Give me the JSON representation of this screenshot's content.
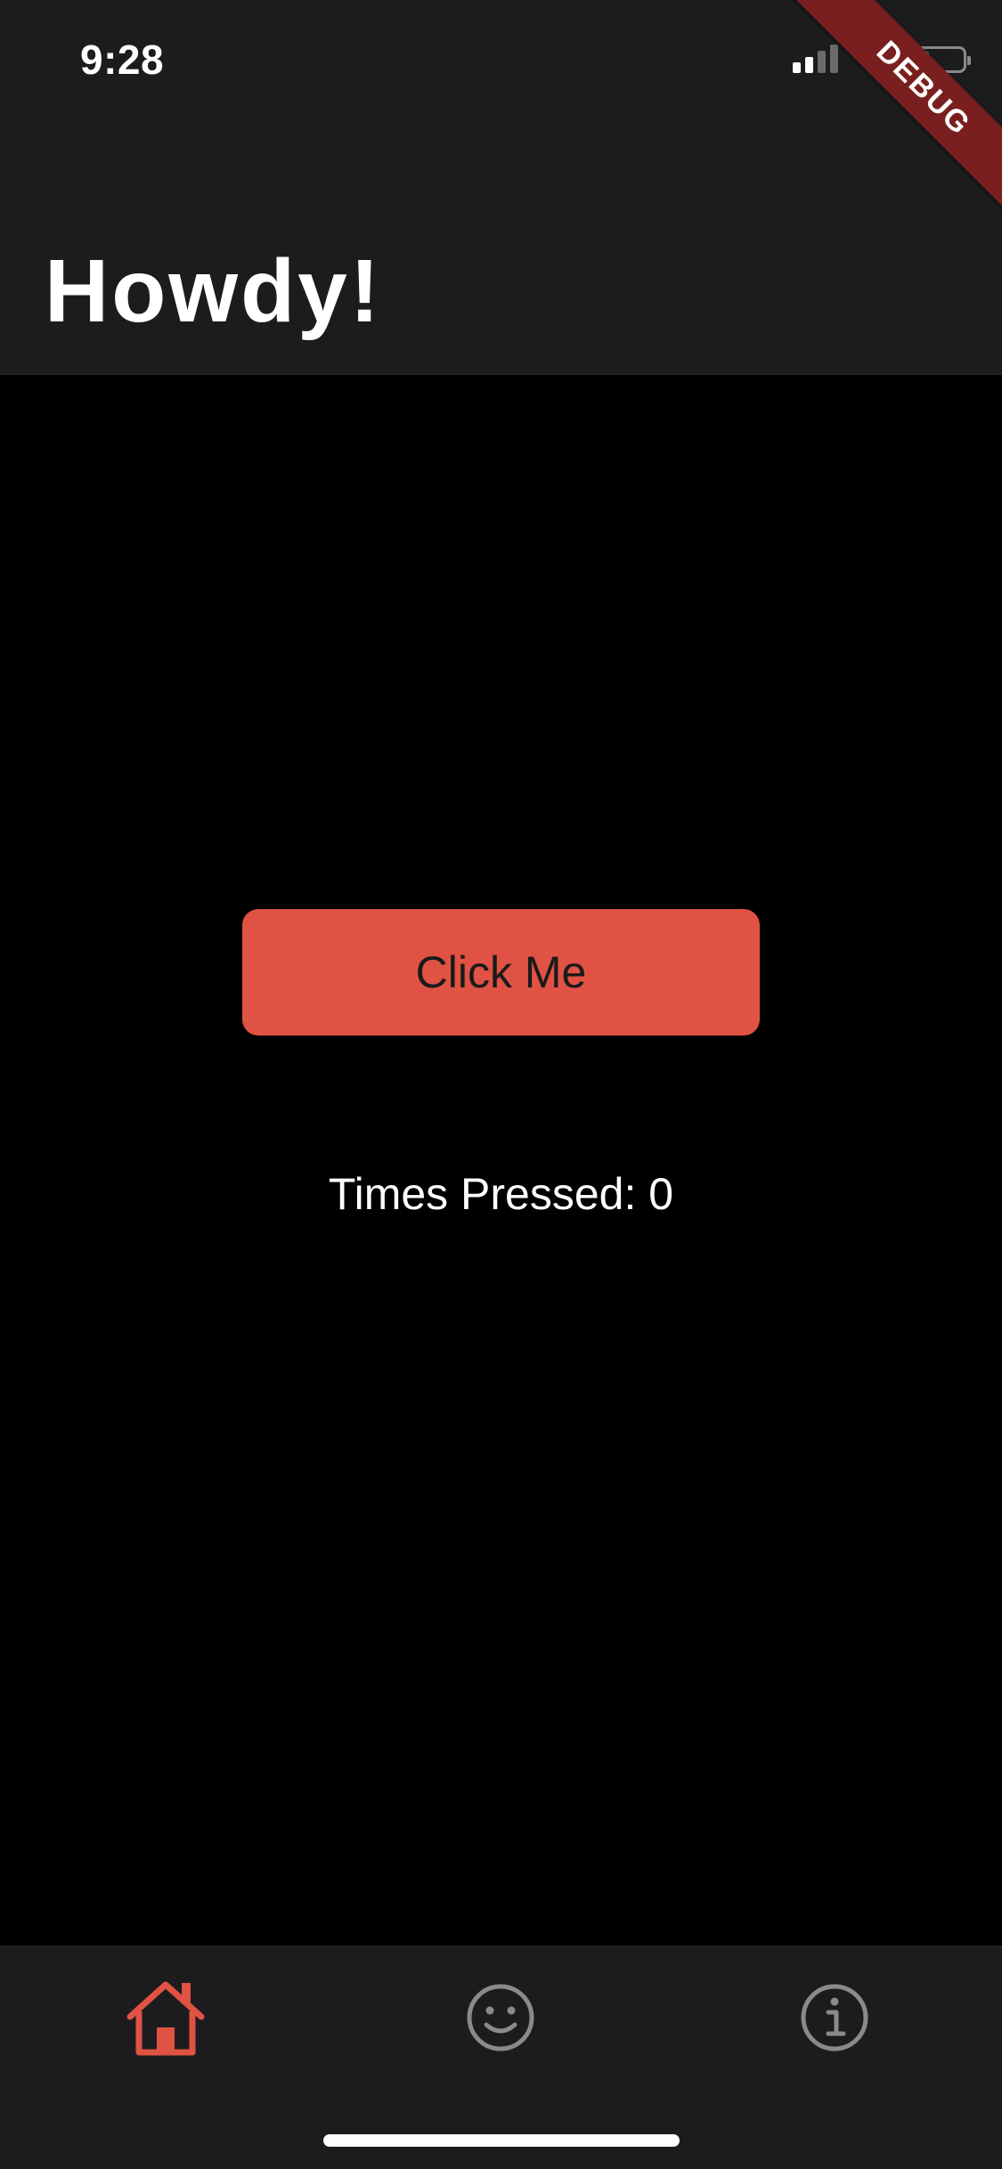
{
  "status_bar": {
    "time": "9:28",
    "signal_bars_active": 2,
    "signal_bars_total": 4,
    "battery_level": 0.25,
    "battery_color": "#34c759"
  },
  "debug_banner": "DEBUG",
  "header": {
    "title": "Howdy!"
  },
  "main": {
    "button_label": "Click Me",
    "counter_text": "Times Pressed: 0"
  },
  "tab_bar": {
    "tabs": [
      {
        "icon": "home-icon",
        "active": true
      },
      {
        "icon": "smile-icon",
        "active": false
      },
      {
        "icon": "info-icon",
        "active": false
      }
    ],
    "active_color": "#e05243",
    "inactive_color": "#8a8a8d"
  },
  "colors": {
    "accent": "#e05243",
    "background": "#000000",
    "bar_background": "#1c1c1e",
    "debug_ribbon": "#7a1f1f"
  }
}
